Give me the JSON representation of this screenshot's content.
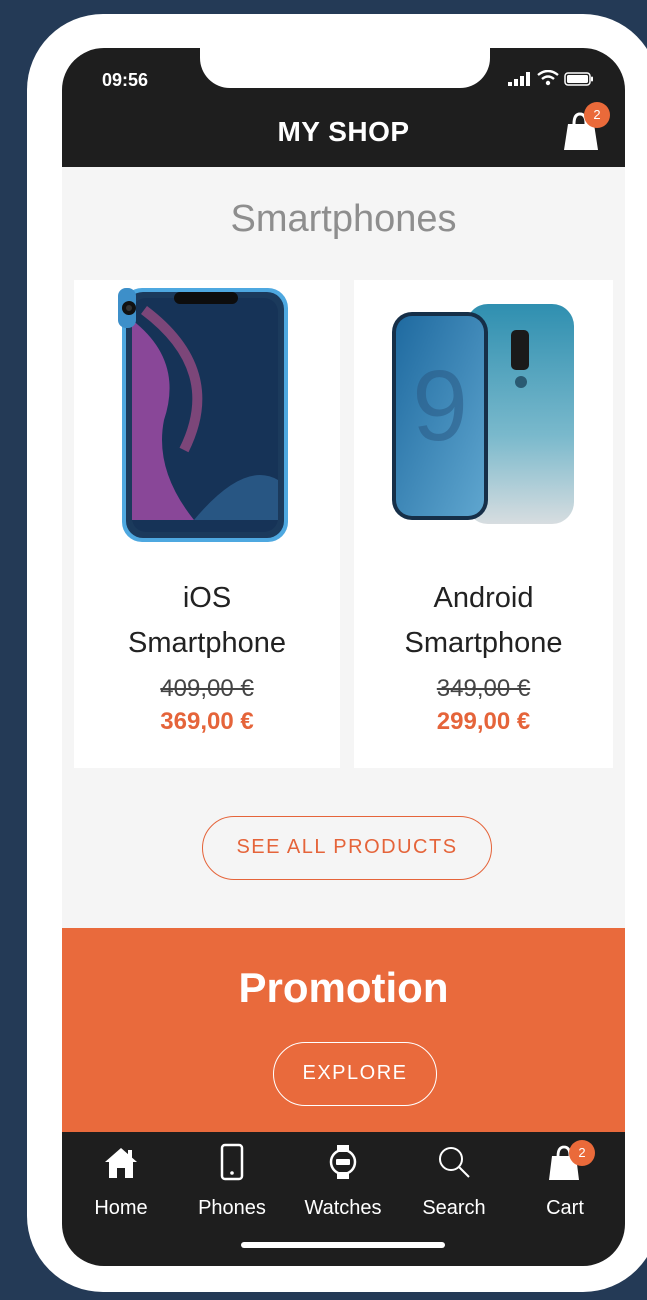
{
  "status": {
    "time": "09:56"
  },
  "header": {
    "title": "MY SHOP",
    "cart_count": "2"
  },
  "section": {
    "title": "Smartphones"
  },
  "products": [
    {
      "name_line1": "iOS",
      "name_line2": "Smartphone",
      "old_price": "409,00 €",
      "new_price": "369,00 €"
    },
    {
      "name_line1": "Android",
      "name_line2": "Smartphone",
      "old_price": "349,00 €",
      "new_price": "299,00 €"
    }
  ],
  "see_all": {
    "label": "SEE ALL PRODUCTS"
  },
  "promo": {
    "title": "Promotion",
    "button_label": "EXPLORE"
  },
  "tabs": [
    {
      "label": "Home",
      "icon": "home-icon"
    },
    {
      "label": "Phones",
      "icon": "phone-icon"
    },
    {
      "label": "Watches",
      "icon": "watch-icon"
    },
    {
      "label": "Search",
      "icon": "search-icon"
    },
    {
      "label": "Cart",
      "icon": "cart-icon",
      "badge": "2"
    }
  ],
  "colors": {
    "accent": "#e96a3c",
    "bar": "#1e1e1e",
    "background": "#243a56"
  }
}
